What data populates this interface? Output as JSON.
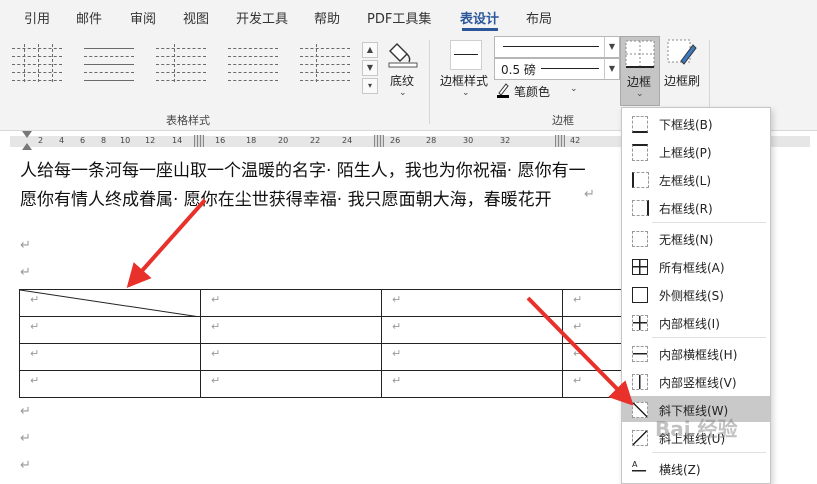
{
  "tabs": [
    {
      "label": "引用",
      "active": false
    },
    {
      "label": "邮件",
      "active": false
    },
    {
      "label": "审阅",
      "active": false
    },
    {
      "label": "视图",
      "active": false
    },
    {
      "label": "开发工具",
      "active": false
    },
    {
      "label": "帮助",
      "active": false
    },
    {
      "label": "PDF工具集",
      "active": false
    },
    {
      "label": "表设计",
      "active": true
    },
    {
      "label": "布局",
      "active": false
    }
  ],
  "ribbon": {
    "table_styles_group": "表格样式",
    "shading_label": "底纹",
    "borders_group": "边框",
    "border_styles_label": "边框样式",
    "pen_weight": "0.5 磅",
    "pen_color_label": "笔颜色",
    "borders_button_label": "边框",
    "border_painter_label": "边框刷"
  },
  "ruler": {
    "numbers": [
      "2",
      "4",
      "6",
      "8",
      "10",
      "12",
      "14",
      "16",
      "18",
      "20",
      "22",
      "24",
      "26",
      "28",
      "30",
      "32",
      "42"
    ]
  },
  "document": {
    "line1": "人给每一条河每一座山取一个温暖的名字· 陌生人，我也为你祝福· 愿你有一",
    "line2": "愿你有情人终成眷属· 愿你在尘世获得幸福· 我只愿面朝大海，春暖花开",
    "paragraph_mark": "↵"
  },
  "borders_menu": {
    "items": [
      {
        "label": "下框线(B)",
        "icon": "bottom-border-icon",
        "highlighted": false
      },
      {
        "label": "上框线(P)",
        "icon": "top-border-icon",
        "highlighted": false
      },
      {
        "label": "左框线(L)",
        "icon": "left-border-icon",
        "highlighted": false
      },
      {
        "label": "右框线(R)",
        "icon": "right-border-icon",
        "highlighted": false
      },
      {
        "label": "无框线(N)",
        "icon": "no-border-icon",
        "highlighted": false
      },
      {
        "label": "所有框线(A)",
        "icon": "all-borders-icon",
        "highlighted": false
      },
      {
        "label": "外侧框线(S)",
        "icon": "outside-borders-icon",
        "highlighted": false
      },
      {
        "label": "内部框线(I)",
        "icon": "inside-borders-icon",
        "highlighted": false
      },
      {
        "label": "内部横框线(H)",
        "icon": "inside-horizontal-border-icon",
        "highlighted": false
      },
      {
        "label": "内部竖框线(V)",
        "icon": "inside-vertical-border-icon",
        "highlighted": false
      },
      {
        "label": "斜下框线(W)",
        "icon": "diagonal-down-border-icon",
        "highlighted": true
      },
      {
        "label": "斜上框线(U)",
        "icon": "diagonal-up-border-icon",
        "highlighted": false
      },
      {
        "label": "横线(Z)",
        "icon": "horizontal-line-icon",
        "highlighted": false
      }
    ]
  },
  "watermark": "Bai 经验",
  "colors": {
    "accent": "#2b579a",
    "arrow": "#e8312a",
    "menu_highlight": "#c9c9c9"
  }
}
